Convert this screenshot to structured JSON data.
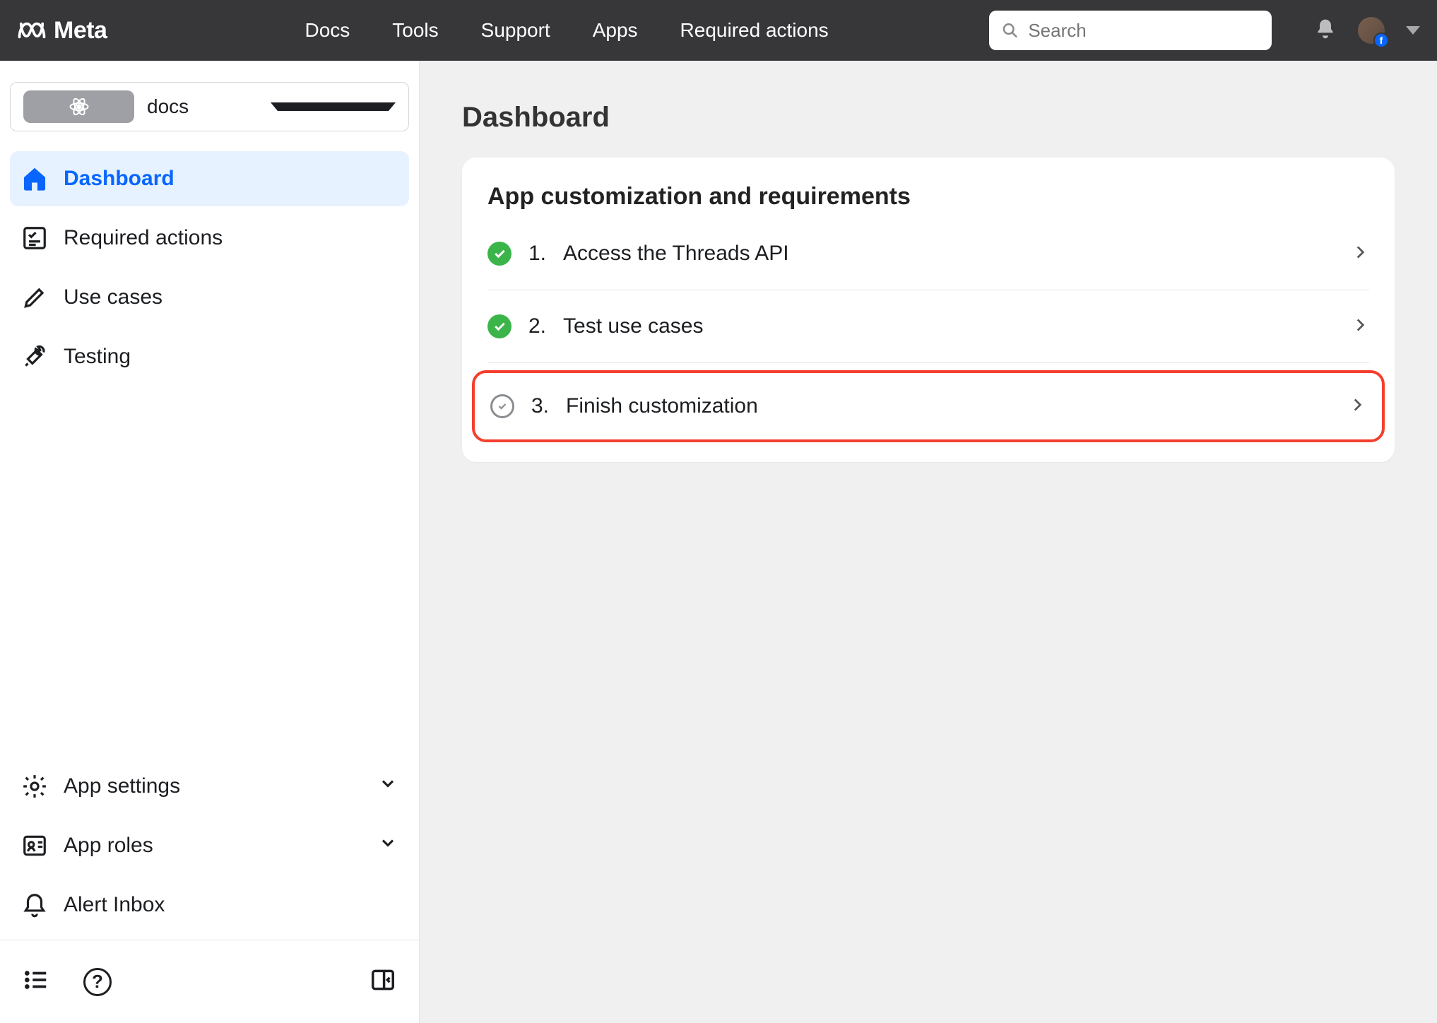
{
  "brand": {
    "name": "Meta"
  },
  "nav": {
    "docs": "Docs",
    "tools": "Tools",
    "support": "Support",
    "apps": "Apps",
    "required_actions": "Required actions"
  },
  "search": {
    "placeholder": "Search"
  },
  "sidebar": {
    "app_selector": {
      "name": "docs"
    },
    "items": [
      {
        "label": "Dashboard"
      },
      {
        "label": "Required actions"
      },
      {
        "label": "Use cases"
      },
      {
        "label": "Testing"
      }
    ],
    "bottom": [
      {
        "label": "App settings"
      },
      {
        "label": "App roles"
      },
      {
        "label": "Alert Inbox"
      }
    ]
  },
  "main": {
    "title": "Dashboard",
    "card": {
      "title": "App customization and requirements",
      "steps": [
        {
          "num": "1.",
          "label": "Access the Threads API"
        },
        {
          "num": "2.",
          "label": "Test use cases"
        },
        {
          "num": "3.",
          "label": "Finish customization"
        }
      ]
    }
  }
}
